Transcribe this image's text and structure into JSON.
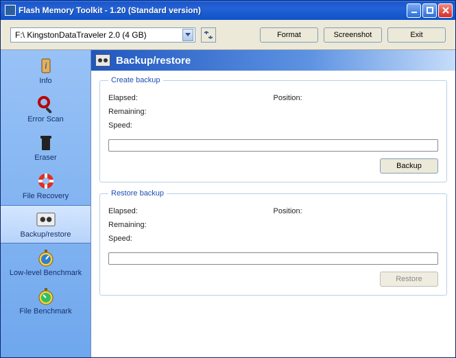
{
  "window": {
    "title": "Flash Memory Toolkit - 1.20 (Standard version)"
  },
  "toolbar": {
    "drive_selected": "F:\\ KingstonDataTraveler 2.0 (4 GB)",
    "format_label": "Format",
    "screenshot_label": "Screenshot",
    "exit_label": "Exit"
  },
  "sidebar": {
    "items": [
      {
        "label": "Info"
      },
      {
        "label": "Error Scan"
      },
      {
        "label": "Eraser"
      },
      {
        "label": "File Recovery"
      },
      {
        "label": "Backup/restore"
      },
      {
        "label": "Low-level Benchmark"
      },
      {
        "label": "File Benchmark"
      }
    ],
    "active_index": 4
  },
  "main": {
    "header": "Backup/restore",
    "create": {
      "legend": "Create backup",
      "elapsed_label": "Elapsed:",
      "elapsed_value": "",
      "remaining_label": "Remaining:",
      "remaining_value": "",
      "speed_label": "Speed:",
      "speed_value": "",
      "position_label": "Position:",
      "position_value": "",
      "button_label": "Backup",
      "button_enabled": true
    },
    "restore": {
      "legend": "Restore backup",
      "elapsed_label": "Elapsed:",
      "elapsed_value": "",
      "remaining_label": "Remaining:",
      "remaining_value": "",
      "speed_label": "Speed:",
      "speed_value": "",
      "position_label": "Position:",
      "position_value": "",
      "button_label": "Restore",
      "button_enabled": false
    }
  }
}
